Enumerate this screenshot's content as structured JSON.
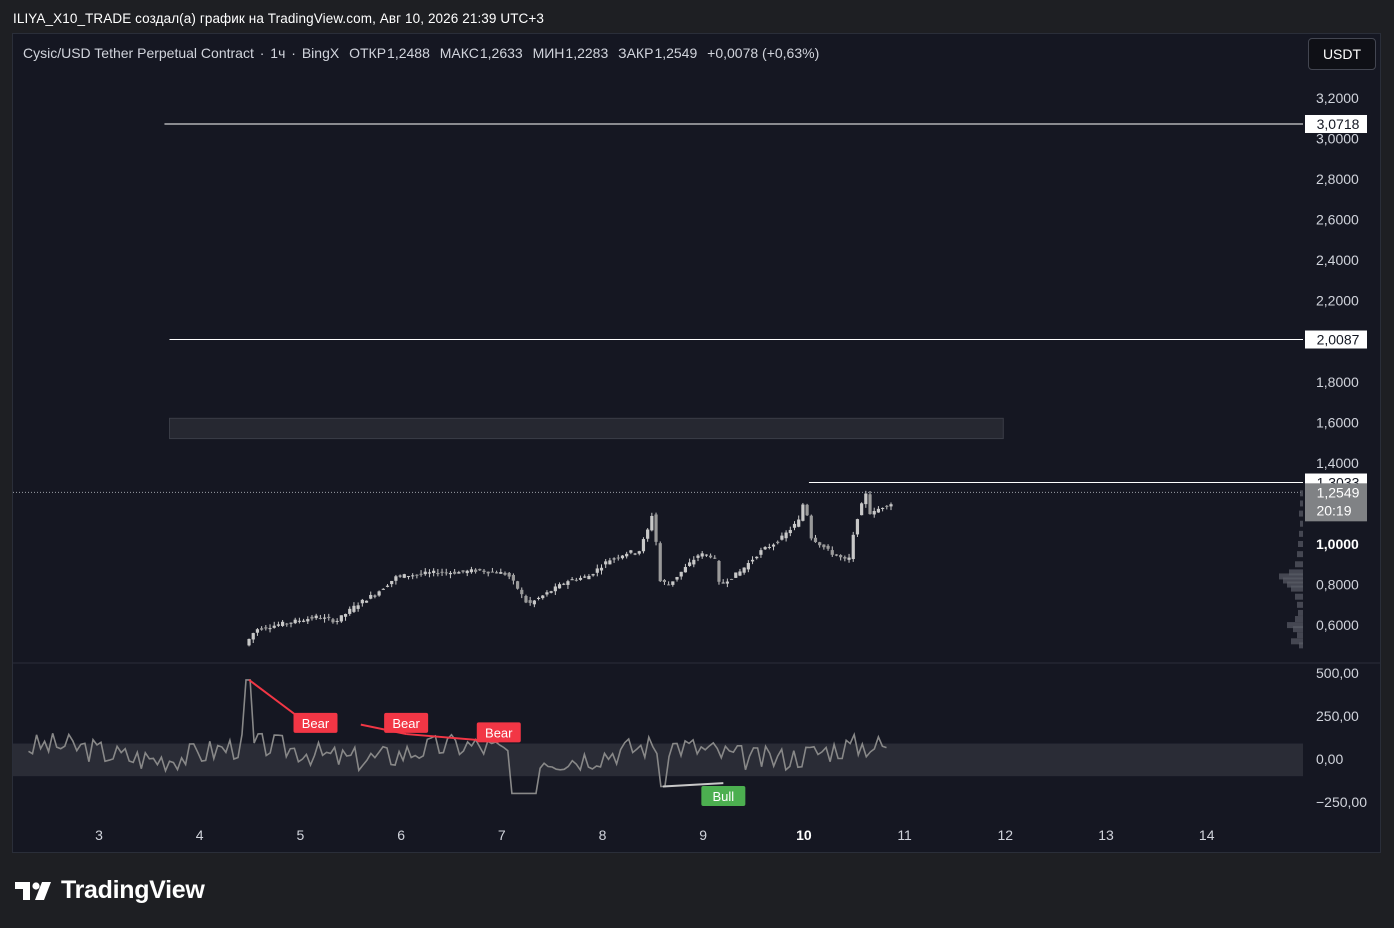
{
  "header": {
    "caption": "ILIYA_X10_TRADE создал(а) график на TradingView.com, Авг 10, 2026 21:39 UTC+3"
  },
  "legend": {
    "symbol": "Cysic/USD Tether Perpetual Contract",
    "interval": "1ч",
    "exchange": "BingX",
    "open_label": "ОТКР",
    "open": "1,2488",
    "high_label": "МАКС",
    "high": "1,2633",
    "low_label": "МИН",
    "low": "1,2283",
    "close_label": "ЗАКР",
    "close": "1,2549",
    "change": "+0,0078 (+0,63%)"
  },
  "currency_button": "USDT",
  "brand": {
    "name": "TradingView",
    "icon": "tradingview-logo-icon"
  },
  "colors": {
    "bg": "#151722",
    "grid_line": "#ffffff",
    "candles": "#c8c8c8",
    "osc": "#888888",
    "bear": "#f23645",
    "bull": "#4caf50"
  },
  "chart_data": [
    {
      "type": "candlestick",
      "title": "Cysic/USD Tether Perpetual Contract · 1ч · BingX",
      "x_ticks": [
        "3",
        "4",
        "5",
        "6",
        "7",
        "8",
        "9",
        "10",
        "11",
        "12",
        "13",
        "14"
      ],
      "x_ticks_bold": [
        "10"
      ],
      "y_ticks": [
        "3,2000",
        "3,0000",
        "2,8000",
        "2,6000",
        "2,4000",
        "2,2000",
        "2,0000",
        "1,8000",
        "1,6000",
        "1,4000",
        "1,2000",
        "1,0000",
        "0,8000",
        "0,6000"
      ],
      "y_ticks_values": [
        3.2,
        3.0,
        2.8,
        2.6,
        2.4,
        2.2,
        2.0,
        1.8,
        1.6,
        1.4,
        1.2,
        1.0,
        0.8,
        0.6
      ],
      "ylim": [
        0.5,
        3.3
      ],
      "x_range_days": [
        2.3,
        15.0
      ],
      "price_path": [
        [
          4.49,
          0.5
        ],
        [
          4.6,
          0.58
        ],
        [
          4.8,
          0.6
        ],
        [
          5.0,
          0.62
        ],
        [
          5.2,
          0.64
        ],
        [
          5.4,
          0.62
        ],
        [
          5.6,
          0.7
        ],
        [
          5.8,
          0.76
        ],
        [
          6.0,
          0.84
        ],
        [
          6.2,
          0.85
        ],
        [
          6.4,
          0.86
        ],
        [
          6.6,
          0.86
        ],
        [
          6.8,
          0.87
        ],
        [
          7.0,
          0.86
        ],
        [
          7.1,
          0.85
        ],
        [
          7.2,
          0.78
        ],
        [
          7.3,
          0.7
        ],
        [
          7.5,
          0.76
        ],
        [
          7.7,
          0.82
        ],
        [
          7.9,
          0.84
        ],
        [
          8.1,
          0.92
        ],
        [
          8.3,
          0.96
        ],
        [
          8.4,
          0.96
        ],
        [
          8.5,
          1.08
        ],
        [
          8.55,
          1.18
        ],
        [
          8.6,
          0.82
        ],
        [
          8.7,
          0.8
        ],
        [
          8.9,
          0.9
        ],
        [
          9.0,
          0.95
        ],
        [
          9.15,
          0.94
        ],
        [
          9.2,
          0.8
        ],
        [
          9.4,
          0.86
        ],
        [
          9.6,
          0.96
        ],
        [
          9.8,
          1.02
        ],
        [
          10.0,
          1.12
        ],
        [
          10.05,
          1.24
        ],
        [
          10.1,
          1.04
        ],
        [
          10.3,
          0.96
        ],
        [
          10.45,
          0.92
        ],
        [
          10.5,
          0.93
        ],
        [
          10.55,
          1.1
        ],
        [
          10.65,
          1.24
        ],
        [
          10.68,
          1.3
        ],
        [
          10.7,
          1.14
        ],
        [
          10.8,
          1.18
        ],
        [
          10.9,
          1.2
        ]
      ],
      "last_price": "1,2549",
      "countdown": "20:19",
      "horizontal_lines": [
        {
          "value": 3.0718,
          "label": "3,0718",
          "from_day": 3.65
        },
        {
          "value": 2.0087,
          "label": "2,0087",
          "from_day": 3.7
        },
        {
          "value": 1.3033,
          "label": "1,3033",
          "from_day": 10.05
        }
      ],
      "zone": {
        "from_day": 3.7,
        "to_day": 11.98,
        "low": 1.52,
        "high": 1.62
      }
    },
    {
      "type": "line",
      "name": "oscillator",
      "y_ticks": [
        "500,00",
        "250,00",
        "0,00",
        "−250,00"
      ],
      "y_ticks_values": [
        500,
        250,
        0,
        -250
      ],
      "ylim": [
        -330,
        560
      ],
      "band": [
        -100,
        90
      ],
      "signals": [
        {
          "label": "Bear",
          "kind": "bear",
          "day": 5.15,
          "value": 210,
          "from": [
            4.49,
            460
          ],
          "to": [
            5.15,
            170
          ]
        },
        {
          "label": "Bear",
          "kind": "bear",
          "day": 6.05,
          "value": 210,
          "from": [
            5.6,
            200
          ],
          "to": [
            6.05,
            145
          ]
        },
        {
          "label": "Bear",
          "kind": "bear",
          "day": 6.97,
          "value": 155,
          "from": [
            6.05,
            145
          ],
          "to": [
            6.97,
            100
          ]
        },
        {
          "label": "Bull",
          "kind": "bull",
          "day": 9.2,
          "value": -215,
          "from": [
            8.6,
            -160
          ],
          "to": [
            9.2,
            -140
          ]
        }
      ]
    }
  ]
}
